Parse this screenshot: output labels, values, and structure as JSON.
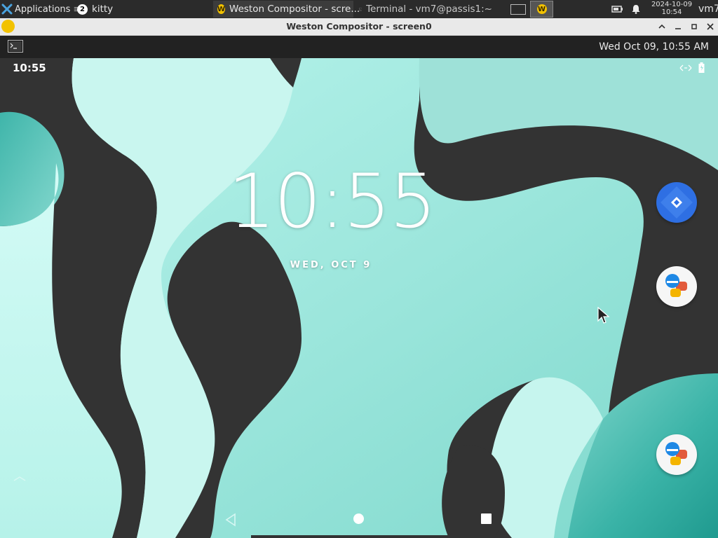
{
  "xfce_panel": {
    "applications_label": "Applications",
    "workspace_badge": "2",
    "tasks": [
      {
        "label": "kitty"
      },
      {
        "label": "Weston Compositor - scre..."
      },
      {
        "label": "Terminal - vm7@passis1:~"
      }
    ],
    "date": "2024-10-09",
    "time": "10:54",
    "user": "vm7"
  },
  "weston_window": {
    "title": "Weston Compositor - screen0",
    "panel_clock": "Wed Oct 09, 10:55 AM"
  },
  "android": {
    "status_time": "10:55",
    "lock_time": "10:55",
    "lock_date": "WED, OCT 9"
  },
  "colors": {
    "xfce_panel_bg": "#2b2b2b",
    "weston_titlebar_bg": "#e9e9e9",
    "weston_panel_bg": "#222222",
    "wallpaper_dark": "#333333",
    "wallpaper_light": "#c8f8f0",
    "wallpaper_teal": "#3fb6ab",
    "icon_blue": "#2f6fe0"
  },
  "icons": [
    "xfce-logo-icon",
    "weston-logo-icon",
    "terminal-icon",
    "battery-icon",
    "bell-icon",
    "signal-icon",
    "android-battery-icon",
    "back-icon",
    "home-icon",
    "recents-icon",
    "swipe-up-icon",
    "maps-app-icon",
    "chat-app-icon"
  ]
}
